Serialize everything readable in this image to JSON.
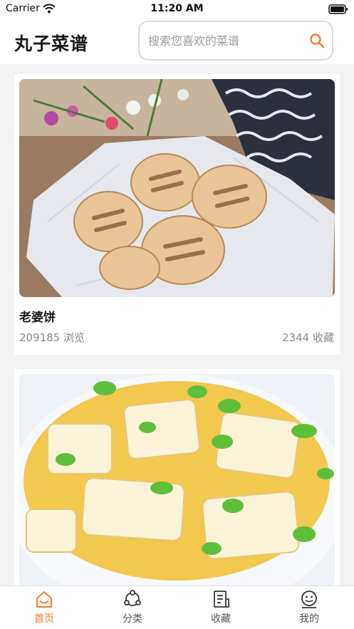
{
  "status_bar": {
    "carrier": "Carrier",
    "time": "11:20 AM"
  },
  "header": {
    "title": "丸子菜谱",
    "search": {
      "placeholder": "搜索您喜欢的菜谱",
      "value": ""
    }
  },
  "recipes": [
    {
      "title": "老婆饼",
      "views": "209185 浏览",
      "favorites": "2344 收藏",
      "image_icon": "pastry-photo"
    },
    {
      "title": "",
      "views": "",
      "favorites": "",
      "image_icon": "tofu-egg-photo"
    }
  ],
  "tab_bar": {
    "items": [
      {
        "label": "首页",
        "icon": "home-icon",
        "active": true
      },
      {
        "label": "分类",
        "icon": "category-icon",
        "active": false
      },
      {
        "label": "收藏",
        "icon": "favorites-icon",
        "active": false
      },
      {
        "label": "我的",
        "icon": "profile-icon",
        "active": false
      }
    ]
  },
  "colors": {
    "accent": "#f07c2c",
    "background": "#f3f3f3",
    "card": "#ffffff",
    "muted_text": "#8a8a8a"
  }
}
